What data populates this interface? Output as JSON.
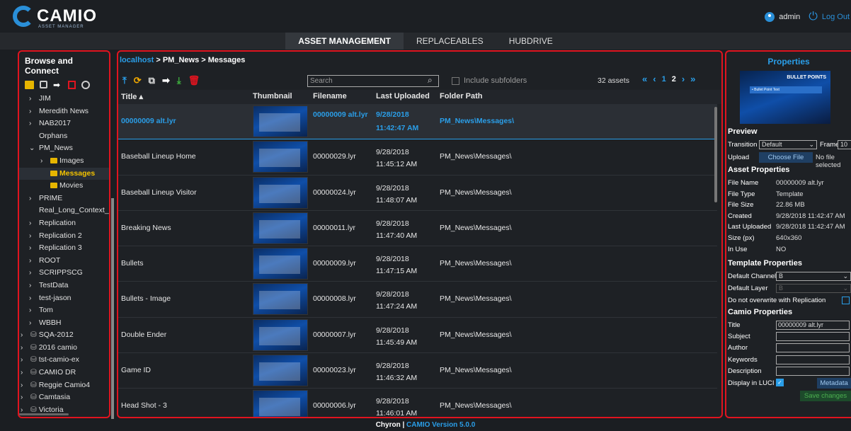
{
  "header": {
    "logo_text": "CAMIO",
    "logo_sub": "ASSET MANAGER",
    "user": "admin",
    "logout": "Log Out"
  },
  "nav": {
    "tabs": [
      "ASSET MANAGEMENT",
      "REPLACEABLES",
      "HUBDRIVE"
    ]
  },
  "sidebar": {
    "title": "Browse and Connect",
    "tree": [
      {
        "label": "JIM",
        "chev": "›",
        "indent": 1
      },
      {
        "label": "Meredith News",
        "chev": "›",
        "indent": 1
      },
      {
        "label": "NAB2017",
        "chev": "›",
        "indent": 1
      },
      {
        "label": "Orphans",
        "chev": "",
        "indent": 1
      },
      {
        "label": "PM_News",
        "chev": "⌄",
        "indent": 1
      },
      {
        "label": "Images",
        "chev": "›",
        "indent": 2,
        "folder": true
      },
      {
        "label": "Messages",
        "chev": "",
        "indent": 2,
        "folder": true,
        "selected": true
      },
      {
        "label": "Movies",
        "chev": "",
        "indent": 2,
        "folder": true
      },
      {
        "label": "PRIME",
        "chev": "›",
        "indent": 1
      },
      {
        "label": "Real_Long_Context_Na",
        "chev": "",
        "indent": 1
      },
      {
        "label": "Replication",
        "chev": "›",
        "indent": 1
      },
      {
        "label": "Replication 2",
        "chev": "›",
        "indent": 1
      },
      {
        "label": "Replication 3",
        "chev": "›",
        "indent": 1
      },
      {
        "label": "ROOT",
        "chev": "›",
        "indent": 1
      },
      {
        "label": "SCRIPPSCG",
        "chev": "›",
        "indent": 1
      },
      {
        "label": "TestData",
        "chev": "›",
        "indent": 1
      },
      {
        "label": "test-jason",
        "chev": "›",
        "indent": 1
      },
      {
        "label": "Tom",
        "chev": "›",
        "indent": 1
      },
      {
        "label": "WBBH",
        "chev": "›",
        "indent": 1
      },
      {
        "label": "SQA-2012",
        "chev": "›",
        "indent": 0,
        "server": true
      },
      {
        "label": "2016 camio",
        "chev": "›",
        "indent": 0,
        "server": true
      },
      {
        "label": "tst-camio-ex",
        "chev": "›",
        "indent": 0,
        "server": true
      },
      {
        "label": "CAMIO DR",
        "chev": "›",
        "indent": 0,
        "server": true
      },
      {
        "label": "Reggie Camio4",
        "chev": "›",
        "indent": 0,
        "server": true
      },
      {
        "label": "Camtasia",
        "chev": "›",
        "indent": 0,
        "server": true
      },
      {
        "label": "Victoria",
        "chev": "›",
        "indent": 0,
        "server": true
      },
      {
        "label": "ENG-MWU",
        "chev": "›",
        "indent": 0,
        "server": true
      }
    ]
  },
  "main": {
    "breadcrumb_host": "localhost",
    "breadcrumb_rest": " > PM_News > Messages",
    "search_placeholder": "Search",
    "include_subfolders": "Include subfolders",
    "asset_count": "32 assets",
    "pages": [
      "1",
      "2"
    ],
    "columns": [
      "Title ▴",
      "Thumbnail",
      "Filename",
      "Last Uploaded",
      "Folder Path"
    ],
    "rows": [
      {
        "title": "00000009 alt.lyr",
        "file": "00000009 alt.lyr",
        "date": "9/28/2018 11:42:47 AM",
        "path": "PM_News\\Messages\\",
        "active": true
      },
      {
        "title": "Baseball Lineup Home",
        "file": "00000029.lyr",
        "date": "9/28/2018 11:45:12 AM",
        "path": "PM_News\\Messages\\"
      },
      {
        "title": "Baseball Lineup Visitor",
        "file": "00000024.lyr",
        "date": "9/28/2018 11:48:07 AM",
        "path": "PM_News\\Messages\\"
      },
      {
        "title": "Breaking News",
        "file": "00000011.lyr",
        "date": "9/28/2018 11:47:40 AM",
        "path": "PM_News\\Messages\\"
      },
      {
        "title": "Bullets",
        "file": "00000009.lyr",
        "date": "9/28/2018 11:47:15 AM",
        "path": "PM_News\\Messages\\"
      },
      {
        "title": "Bullets - Image",
        "file": "00000008.lyr",
        "date": "9/28/2018 11:47:24 AM",
        "path": "PM_News\\Messages\\"
      },
      {
        "title": "Double Ender",
        "file": "00000007.lyr",
        "date": "9/28/2018 11:45:49 AM",
        "path": "PM_News\\Messages\\"
      },
      {
        "title": "Game ID",
        "file": "00000023.lyr",
        "date": "9/28/2018 11:46:32 AM",
        "path": "PM_News\\Messages\\"
      },
      {
        "title": "Head Shot - 3",
        "file": "00000006.lyr",
        "date": "9/28/2018 11:46:01 AM",
        "path": "PM_News\\Messages\\"
      }
    ]
  },
  "properties": {
    "title": "Properties",
    "preview_label": "BULLET POINTS",
    "preview_bar": "• Bullet Point Text",
    "preview_section": "Preview",
    "transition_label": "Transition",
    "transition_value": "Default",
    "frame_label": "Frame",
    "frame_value": "10",
    "upload_label": "Upload",
    "choose_file": "Choose File",
    "no_file": "No file selected",
    "asset_section": "Asset Properties",
    "asset": [
      {
        "k": "File Name",
        "v": "00000009 alt.lyr"
      },
      {
        "k": "File Type",
        "v": "Template"
      },
      {
        "k": "File Size",
        "v": "22.86 MB"
      },
      {
        "k": "Created",
        "v": "9/28/2018 11:42:47 AM"
      },
      {
        "k": "Last Uploaded",
        "v": "9/28/2018 11:42:47 AM"
      },
      {
        "k": "Size (px)",
        "v": "640x360"
      },
      {
        "k": "In Use",
        "v": "NO"
      }
    ],
    "template_section": "Template Properties",
    "default_channel_label": "Default Channel",
    "default_channel_value": "B",
    "default_layer_label": "Default Layer",
    "default_layer_value": "B",
    "no_overwrite_label": "Do not overwrite with Replication",
    "camio_section": "Camio Properties",
    "camio": [
      {
        "k": "Title",
        "v": "00000009 alt.lyr"
      },
      {
        "k": "Subject",
        "v": ""
      },
      {
        "k": "Author",
        "v": ""
      },
      {
        "k": "Keywords",
        "v": ""
      },
      {
        "k": "Description",
        "v": ""
      }
    ],
    "display_luci_label": "Display in LUCI",
    "metadata_btn": "Metadata",
    "save_btn": "Save changes"
  },
  "footer": {
    "brand": "Chyron",
    "sep": " | ",
    "version": "CAMIO Version 5.0.0"
  },
  "colors": {
    "accent": "#2a9ee8",
    "highlight_border": "#e0141f",
    "folder": "#e6b500"
  }
}
